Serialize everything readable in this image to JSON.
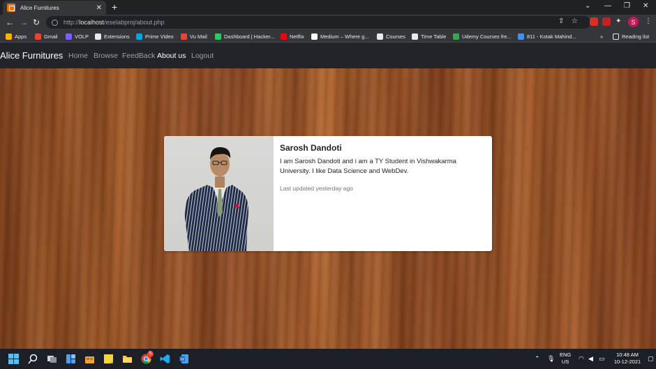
{
  "browser": {
    "tab_title": "Alice Furnitures",
    "url_host": "localhost",
    "url_prefix": "http://",
    "url_path": "/eselabproj/about.php",
    "profile_initial": "S"
  },
  "bookmarks": [
    {
      "label": "Apps",
      "icon": "apps-grid-icon",
      "color": "#f4b400"
    },
    {
      "label": "Gmail",
      "icon": "gmail-icon",
      "color": "#ea4335"
    },
    {
      "label": "VOLP",
      "icon": "volp-icon",
      "color": "#7b61ff"
    },
    {
      "label": "Extensions",
      "icon": "puzzle-icon",
      "color": "#e8eaed"
    },
    {
      "label": "Prime Video",
      "icon": "prime-video-icon",
      "color": "#00a8e1"
    },
    {
      "label": "Vu Mail",
      "icon": "mail-icon",
      "color": "#ea4335"
    },
    {
      "label": "Dashboard | Hacker...",
      "icon": "hackerrank-icon",
      "color": "#2ec866"
    },
    {
      "label": "Netflix",
      "icon": "netflix-icon",
      "color": "#e50914"
    },
    {
      "label": "Medium – Where g...",
      "icon": "medium-icon",
      "color": "#ffffff"
    },
    {
      "label": "Courses",
      "icon": "globe-icon",
      "color": "#e8eaed"
    },
    {
      "label": "Time Table",
      "icon": "globe-icon",
      "color": "#e8eaed"
    },
    {
      "label": "Udemy Courses fre...",
      "icon": "udemy-icon",
      "color": "#34a853"
    },
    {
      "label": "811 - Kotak Mahind...",
      "icon": "kotak-icon",
      "color": "#4a90e2"
    }
  ],
  "reading_list_label": "Reading list",
  "nav": {
    "brand": "Alice Furnitures",
    "links": [
      "Home",
      "Browse",
      "FeedBack",
      "About us",
      "Logout"
    ],
    "active": "About us"
  },
  "card": {
    "name": "Sarosh Dandoti",
    "description": "I am Sarosh Dandoti and i am a TY Student in Vishwakarma University. I like Data Science and WebDev.",
    "updated": "Last updated yesterday ago"
  },
  "taskbar": {
    "lang_line1": "ENG",
    "lang_line2": "US",
    "time": "10:48 AM",
    "date": "10-12-2021",
    "chrome_badge": "5"
  },
  "colors": {
    "navbar_bg": "#212529",
    "card_bg": "#ffffff",
    "text_muted": "#6c757d",
    "browser_dark": "#202124"
  }
}
